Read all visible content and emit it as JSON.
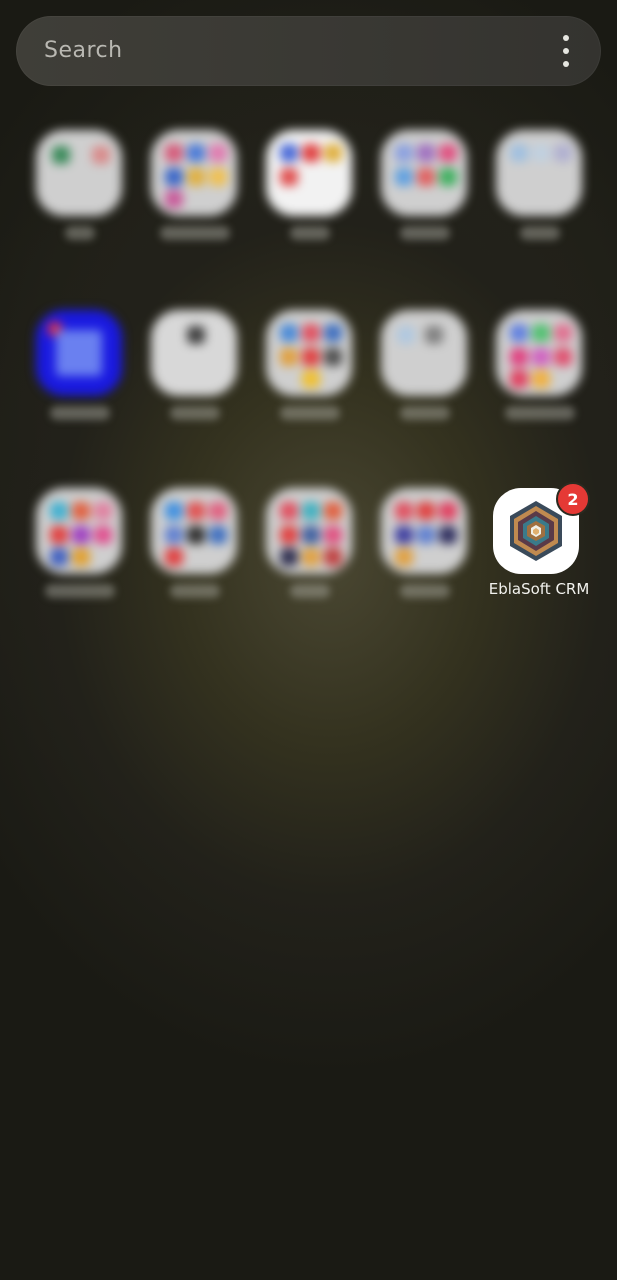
{
  "search": {
    "placeholder": "Search"
  },
  "menu": {
    "icon": "more-vert-icon"
  },
  "apps": {
    "eblasoft_crm": {
      "label": "EblaSoft CRM",
      "badge_count": "2",
      "icon": "eblasoft-crm-hexagon-icon"
    }
  },
  "colors": {
    "badge": "#e53935",
    "search_bar": "#3c3b36",
    "label_text": "#f2f2ee"
  }
}
